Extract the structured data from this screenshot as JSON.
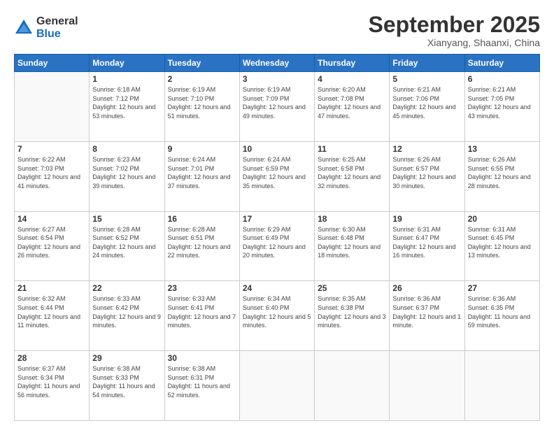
{
  "logo": {
    "general": "General",
    "blue": "Blue"
  },
  "title": "September 2025",
  "location": "Xianyang, Shaanxi, China",
  "weekdays": [
    "Sunday",
    "Monday",
    "Tuesday",
    "Wednesday",
    "Thursday",
    "Friday",
    "Saturday"
  ],
  "weeks": [
    [
      {
        "day": "",
        "sunrise": "",
        "sunset": "",
        "daylight": ""
      },
      {
        "day": "1",
        "sunrise": "Sunrise: 6:18 AM",
        "sunset": "Sunset: 7:12 PM",
        "daylight": "Daylight: 12 hours and 53 minutes."
      },
      {
        "day": "2",
        "sunrise": "Sunrise: 6:19 AM",
        "sunset": "Sunset: 7:10 PM",
        "daylight": "Daylight: 12 hours and 51 minutes."
      },
      {
        "day": "3",
        "sunrise": "Sunrise: 6:19 AM",
        "sunset": "Sunset: 7:09 PM",
        "daylight": "Daylight: 12 hours and 49 minutes."
      },
      {
        "day": "4",
        "sunrise": "Sunrise: 6:20 AM",
        "sunset": "Sunset: 7:08 PM",
        "daylight": "Daylight: 12 hours and 47 minutes."
      },
      {
        "day": "5",
        "sunrise": "Sunrise: 6:21 AM",
        "sunset": "Sunset: 7:06 PM",
        "daylight": "Daylight: 12 hours and 45 minutes."
      },
      {
        "day": "6",
        "sunrise": "Sunrise: 6:21 AM",
        "sunset": "Sunset: 7:05 PM",
        "daylight": "Daylight: 12 hours and 43 minutes."
      }
    ],
    [
      {
        "day": "7",
        "sunrise": "Sunrise: 6:22 AM",
        "sunset": "Sunset: 7:03 PM",
        "daylight": "Daylight: 12 hours and 41 minutes."
      },
      {
        "day": "8",
        "sunrise": "Sunrise: 6:23 AM",
        "sunset": "Sunset: 7:02 PM",
        "daylight": "Daylight: 12 hours and 39 minutes."
      },
      {
        "day": "9",
        "sunrise": "Sunrise: 6:24 AM",
        "sunset": "Sunset: 7:01 PM",
        "daylight": "Daylight: 12 hours and 37 minutes."
      },
      {
        "day": "10",
        "sunrise": "Sunrise: 6:24 AM",
        "sunset": "Sunset: 6:59 PM",
        "daylight": "Daylight: 12 hours and 35 minutes."
      },
      {
        "day": "11",
        "sunrise": "Sunrise: 6:25 AM",
        "sunset": "Sunset: 6:58 PM",
        "daylight": "Daylight: 12 hours and 32 minutes."
      },
      {
        "day": "12",
        "sunrise": "Sunrise: 6:26 AM",
        "sunset": "Sunset: 6:57 PM",
        "daylight": "Daylight: 12 hours and 30 minutes."
      },
      {
        "day": "13",
        "sunrise": "Sunrise: 6:26 AM",
        "sunset": "Sunset: 6:55 PM",
        "daylight": "Daylight: 12 hours and 28 minutes."
      }
    ],
    [
      {
        "day": "14",
        "sunrise": "Sunrise: 6:27 AM",
        "sunset": "Sunset: 6:54 PM",
        "daylight": "Daylight: 12 hours and 26 minutes."
      },
      {
        "day": "15",
        "sunrise": "Sunrise: 6:28 AM",
        "sunset": "Sunset: 6:52 PM",
        "daylight": "Daylight: 12 hours and 24 minutes."
      },
      {
        "day": "16",
        "sunrise": "Sunrise: 6:28 AM",
        "sunset": "Sunset: 6:51 PM",
        "daylight": "Daylight: 12 hours and 22 minutes."
      },
      {
        "day": "17",
        "sunrise": "Sunrise: 6:29 AM",
        "sunset": "Sunset: 6:49 PM",
        "daylight": "Daylight: 12 hours and 20 minutes."
      },
      {
        "day": "18",
        "sunrise": "Sunrise: 6:30 AM",
        "sunset": "Sunset: 6:48 PM",
        "daylight": "Daylight: 12 hours and 18 minutes."
      },
      {
        "day": "19",
        "sunrise": "Sunrise: 6:31 AM",
        "sunset": "Sunset: 6:47 PM",
        "daylight": "Daylight: 12 hours and 16 minutes."
      },
      {
        "day": "20",
        "sunrise": "Sunrise: 6:31 AM",
        "sunset": "Sunset: 6:45 PM",
        "daylight": "Daylight: 12 hours and 13 minutes."
      }
    ],
    [
      {
        "day": "21",
        "sunrise": "Sunrise: 6:32 AM",
        "sunset": "Sunset: 6:44 PM",
        "daylight": "Daylight: 12 hours and 11 minutes."
      },
      {
        "day": "22",
        "sunrise": "Sunrise: 6:33 AM",
        "sunset": "Sunset: 6:42 PM",
        "daylight": "Daylight: 12 hours and 9 minutes."
      },
      {
        "day": "23",
        "sunrise": "Sunrise: 6:33 AM",
        "sunset": "Sunset: 6:41 PM",
        "daylight": "Daylight: 12 hours and 7 minutes."
      },
      {
        "day": "24",
        "sunrise": "Sunrise: 6:34 AM",
        "sunset": "Sunset: 6:40 PM",
        "daylight": "Daylight: 12 hours and 5 minutes."
      },
      {
        "day": "25",
        "sunrise": "Sunrise: 6:35 AM",
        "sunset": "Sunset: 6:38 PM",
        "daylight": "Daylight: 12 hours and 3 minutes."
      },
      {
        "day": "26",
        "sunrise": "Sunrise: 6:36 AM",
        "sunset": "Sunset: 6:37 PM",
        "daylight": "Daylight: 12 hours and 1 minute."
      },
      {
        "day": "27",
        "sunrise": "Sunrise: 6:36 AM",
        "sunset": "Sunset: 6:35 PM",
        "daylight": "Daylight: 11 hours and 59 minutes."
      }
    ],
    [
      {
        "day": "28",
        "sunrise": "Sunrise: 6:37 AM",
        "sunset": "Sunset: 6:34 PM",
        "daylight": "Daylight: 11 hours and 56 minutes."
      },
      {
        "day": "29",
        "sunrise": "Sunrise: 6:38 AM",
        "sunset": "Sunset: 6:33 PM",
        "daylight": "Daylight: 11 hours and 54 minutes."
      },
      {
        "day": "30",
        "sunrise": "Sunrise: 6:38 AM",
        "sunset": "Sunset: 6:31 PM",
        "daylight": "Daylight: 11 hours and 52 minutes."
      },
      {
        "day": "",
        "sunrise": "",
        "sunset": "",
        "daylight": ""
      },
      {
        "day": "",
        "sunrise": "",
        "sunset": "",
        "daylight": ""
      },
      {
        "day": "",
        "sunrise": "",
        "sunset": "",
        "daylight": ""
      },
      {
        "day": "",
        "sunrise": "",
        "sunset": "",
        "daylight": ""
      }
    ]
  ]
}
